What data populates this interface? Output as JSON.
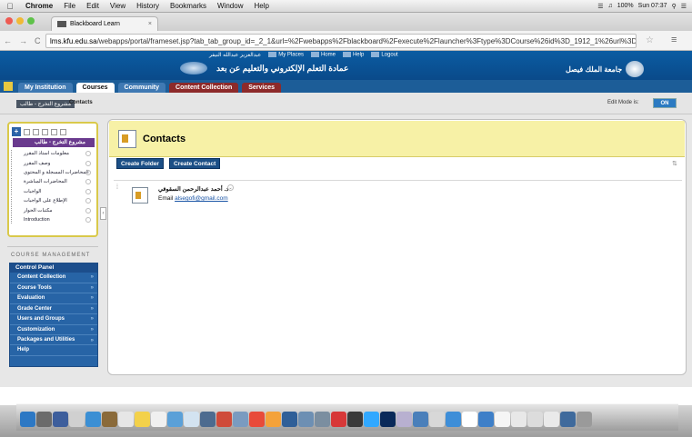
{
  "menubar": {
    "app": "Chrome",
    "items": [
      "File",
      "Edit",
      "View",
      "History",
      "Bookmarks",
      "Window",
      "Help"
    ],
    "battery": "100%",
    "clock": "Sun 07:37"
  },
  "browser": {
    "tab_title": "Blackboard Learn",
    "url_domain": "lms.kfu.edu.sa",
    "url_path": "/webapps/portal/frameset.jsp?tab_tab_group_id=_2_1&url=%2Fwebapps%2Fblackboard%2Fexecute%2Flauncher%3Ftype%3DCourse%26id%3D_1912_1%26url%3D"
  },
  "header": {
    "user": "عبدالعزيز عبدالله النيفر",
    "links": [
      "My Places",
      "Home",
      "Help",
      "Logout"
    ],
    "title": "عمادة التعلم الإلكتروني والتعليم عن بعد",
    "university": "جامعة الملك فيصل"
  },
  "tabs": [
    "My Institution",
    "Courses",
    "Community",
    "Content Collection",
    "Services"
  ],
  "breadcrumb": {
    "course": "مشروع التخرج - طالب",
    "current": "Contacts",
    "edit_mode_label": "Edit Mode is:",
    "edit_mode_value": "ON"
  },
  "course_menu": {
    "title": "مشروع التخرج - طالب",
    "items": [
      "معلومات استاذ المقرر",
      "وصف المقرر",
      "المحاضرات المسجلة و المحتوى",
      "المحاضرات المباشرة",
      "الواجبات",
      "الإطلاع على الواجبات",
      "مكتبات الحوار",
      "Introduction"
    ]
  },
  "course_management": {
    "heading": "COURSE MANAGEMENT",
    "panel_title": "Control Panel",
    "items": [
      "Content Collection",
      "Course Tools",
      "Evaluation",
      "Grade Center",
      "Users and Groups",
      "Customization",
      "Packages and Utilities",
      "Help"
    ]
  },
  "content": {
    "title": "Contacts",
    "create_folder": "Create Folder",
    "create_contact": "Create Contact",
    "contact": {
      "name": "د. أحمد عبدالرحمن السقوفي",
      "email_label": "Email",
      "email": "alsegofi@gmail.com"
    }
  },
  "colors": {
    "header_blue": "#0b5ca2",
    "content_title_bg": "#f7f1a6",
    "course_menu_title": "#6a3a8e",
    "control_panel": "#2764a6"
  }
}
